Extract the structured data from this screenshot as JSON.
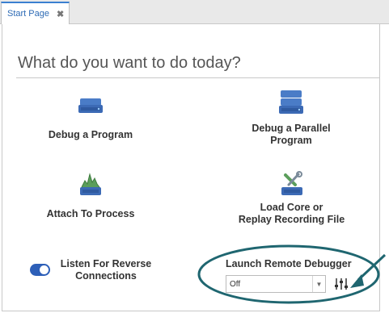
{
  "tab": {
    "label": "Start Page",
    "close_glyph": "✖"
  },
  "heading": "What do you want to do today?",
  "actions": [
    {
      "label_lines": [
        "Debug a Program"
      ],
      "icon": "server-icon"
    },
    {
      "label_lines": [
        "Debug a Parallel",
        "Program"
      ],
      "icon": "stacked-servers-icon"
    },
    {
      "label_lines": [
        "Attach To Process"
      ],
      "icon": "process-attach-icon"
    },
    {
      "label_lines": [
        "Load Core or",
        "Replay Recording File"
      ],
      "icon": "core-file-tools-icon"
    }
  ],
  "listen": {
    "label_lines": [
      "Listen For Reverse",
      "Connections"
    ],
    "enabled": true
  },
  "remote": {
    "title": "Launch Remote Debugger",
    "selected": "Off",
    "settings_icon": "sliders-icon"
  },
  "colors": {
    "accent": "#3a7fd0",
    "icon_blue": "#4a7cc7",
    "toggle": "#2d5fb8",
    "annotation": "#1f6670"
  }
}
